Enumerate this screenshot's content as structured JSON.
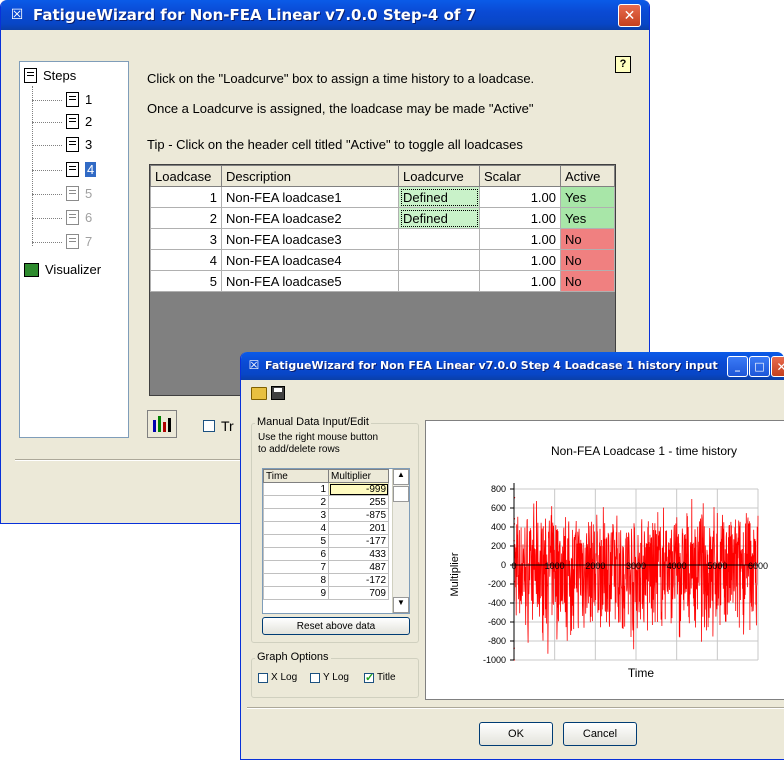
{
  "main_window": {
    "title": "FatigueWizard for Non-FEA Linear v7.0.0 Step-4 of 7",
    "help_icon": "help-question-icon",
    "tree": {
      "root": "Steps",
      "steps": [
        "1",
        "2",
        "3",
        "4",
        "5",
        "6",
        "7"
      ],
      "active_step": "4",
      "visualizer": "Visualizer"
    },
    "instructions": {
      "line1": "Click on the \"Loadcurve\" box to assign a time history to a loadcase.",
      "line2": "Once a Loadcurve is assigned, the loadcase  may be made \"Active\"",
      "line3": "Tip - Click on the header cell titled \"Active\" to toggle all loadcases"
    },
    "table": {
      "headers": [
        "Loadcase",
        "Description",
        "Loadcurve",
        "Scalar",
        "Active"
      ],
      "rows": [
        {
          "loadcase": "1",
          "description": "Non-FEA loadcase1",
          "loadcurve": "Defined",
          "scalar": "1.00",
          "active": "Yes"
        },
        {
          "loadcase": "2",
          "description": "Non-FEA loadcase2",
          "loadcurve": "Defined",
          "scalar": "1.00",
          "active": "Yes"
        },
        {
          "loadcase": "3",
          "description": "Non-FEA loadcase3",
          "loadcurve": "",
          "scalar": "1.00",
          "active": "No"
        },
        {
          "loadcase": "4",
          "description": "Non-FEA loadcase4",
          "loadcurve": "",
          "scalar": "1.00",
          "active": "No"
        },
        {
          "loadcase": "5",
          "description": "Non-FEA loadcase5",
          "loadcurve": "",
          "scalar": "1.00",
          "active": "No"
        }
      ]
    },
    "bottom_checkbox_label": "Tr",
    "colors": {
      "defined": "#c9f2c9",
      "yes": "#a8e6a8",
      "no": "#f08080"
    }
  },
  "dialog": {
    "title": "FatigueWizard for Non FEA Linear v7.0.0 Step 4   Loadcase 1 history input",
    "toolbar": {
      "open_icon": "open-folder-icon",
      "save_icon": "save-disk-icon"
    },
    "manual_group": {
      "label": "Manual Data Input/Edit",
      "hint1": "Use the right mouse button",
      "hint2": "to add/delete rows",
      "headers": [
        "Time",
        "Multiplier"
      ],
      "rows": [
        {
          "time": "1",
          "multiplier": "-999"
        },
        {
          "time": "2",
          "multiplier": "255"
        },
        {
          "time": "3",
          "multiplier": "-875"
        },
        {
          "time": "4",
          "multiplier": "201"
        },
        {
          "time": "5",
          "multiplier": "-177"
        },
        {
          "time": "6",
          "multiplier": "433"
        },
        {
          "time": "7",
          "multiplier": "487"
        },
        {
          "time": "8",
          "multiplier": "-172"
        },
        {
          "time": "9",
          "multiplier": "709"
        }
      ],
      "reset_label": "Reset above data"
    },
    "graph_options": {
      "label": "Graph Options",
      "xlog": "X Log",
      "ylog": "Y Log",
      "title": "Title",
      "xlog_checked": false,
      "ylog_checked": false,
      "title_checked": true
    },
    "ok_label": "OK",
    "cancel_label": "Cancel"
  },
  "chart_data": {
    "type": "line",
    "title": "Non-FEA Loadcase 1 - time history",
    "xlabel": "Time",
    "ylabel": "Multiplier",
    "xlim": [
      0,
      6000
    ],
    "ylim": [
      -1000,
      800
    ],
    "xticks": [
      "0",
      "1000",
      "2000",
      "3000",
      "4000",
      "5000",
      "6000"
    ],
    "yticks": [
      "800",
      "600",
      "400",
      "200",
      "0",
      "-200",
      "-400",
      "-600",
      "-800",
      "-1000"
    ],
    "grid": true,
    "series": [
      {
        "color": "#ff0000",
        "x": [
          1,
          2,
          3,
          4,
          5,
          6,
          7,
          8,
          9
        ],
        "y": [
          -999,
          255,
          -875,
          201,
          -177,
          433,
          487,
          -172,
          709
        ],
        "note_range": [
          0,
          6000
        ]
      }
    ]
  }
}
